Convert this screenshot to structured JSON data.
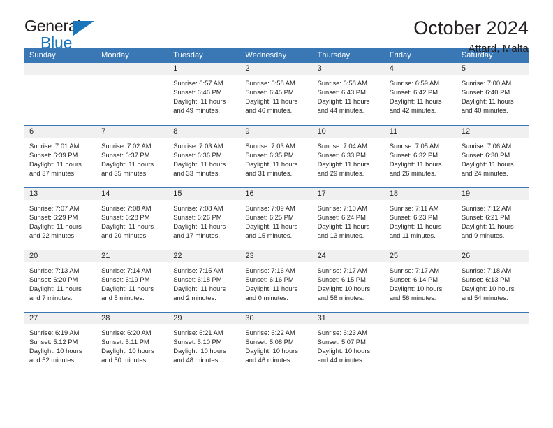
{
  "brand": {
    "name_line1": "General",
    "name_line2": "Blue",
    "accent_color": "#1b75bb"
  },
  "header": {
    "title": "October 2024",
    "subtitle": "Attard, Malta"
  },
  "calendar": {
    "header_bg": "#3a78b5",
    "daynum_band_bg": "#f0f0f0",
    "weekday_headers": [
      "Sunday",
      "Monday",
      "Tuesday",
      "Wednesday",
      "Thursday",
      "Friday",
      "Saturday"
    ],
    "labels": {
      "sunrise": "Sunrise:",
      "sunset": "Sunset:",
      "daylight": "Daylight:"
    },
    "weeks": [
      [
        {
          "empty": true
        },
        {
          "empty": true
        },
        {
          "day": "1",
          "sunrise": "Sunrise: 6:57 AM",
          "sunset": "Sunset: 6:46 PM",
          "daylight_1": "Daylight: 11 hours",
          "daylight_2": "and 49 minutes."
        },
        {
          "day": "2",
          "sunrise": "Sunrise: 6:58 AM",
          "sunset": "Sunset: 6:45 PM",
          "daylight_1": "Daylight: 11 hours",
          "daylight_2": "and 46 minutes."
        },
        {
          "day": "3",
          "sunrise": "Sunrise: 6:58 AM",
          "sunset": "Sunset: 6:43 PM",
          "daylight_1": "Daylight: 11 hours",
          "daylight_2": "and 44 minutes."
        },
        {
          "day": "4",
          "sunrise": "Sunrise: 6:59 AM",
          "sunset": "Sunset: 6:42 PM",
          "daylight_1": "Daylight: 11 hours",
          "daylight_2": "and 42 minutes."
        },
        {
          "day": "5",
          "sunrise": "Sunrise: 7:00 AM",
          "sunset": "Sunset: 6:40 PM",
          "daylight_1": "Daylight: 11 hours",
          "daylight_2": "and 40 minutes."
        }
      ],
      [
        {
          "day": "6",
          "sunrise": "Sunrise: 7:01 AM",
          "sunset": "Sunset: 6:39 PM",
          "daylight_1": "Daylight: 11 hours",
          "daylight_2": "and 37 minutes."
        },
        {
          "day": "7",
          "sunrise": "Sunrise: 7:02 AM",
          "sunset": "Sunset: 6:37 PM",
          "daylight_1": "Daylight: 11 hours",
          "daylight_2": "and 35 minutes."
        },
        {
          "day": "8",
          "sunrise": "Sunrise: 7:03 AM",
          "sunset": "Sunset: 6:36 PM",
          "daylight_1": "Daylight: 11 hours",
          "daylight_2": "and 33 minutes."
        },
        {
          "day": "9",
          "sunrise": "Sunrise: 7:03 AM",
          "sunset": "Sunset: 6:35 PM",
          "daylight_1": "Daylight: 11 hours",
          "daylight_2": "and 31 minutes."
        },
        {
          "day": "10",
          "sunrise": "Sunrise: 7:04 AM",
          "sunset": "Sunset: 6:33 PM",
          "daylight_1": "Daylight: 11 hours",
          "daylight_2": "and 29 minutes."
        },
        {
          "day": "11",
          "sunrise": "Sunrise: 7:05 AM",
          "sunset": "Sunset: 6:32 PM",
          "daylight_1": "Daylight: 11 hours",
          "daylight_2": "and 26 minutes."
        },
        {
          "day": "12",
          "sunrise": "Sunrise: 7:06 AM",
          "sunset": "Sunset: 6:30 PM",
          "daylight_1": "Daylight: 11 hours",
          "daylight_2": "and 24 minutes."
        }
      ],
      [
        {
          "day": "13",
          "sunrise": "Sunrise: 7:07 AM",
          "sunset": "Sunset: 6:29 PM",
          "daylight_1": "Daylight: 11 hours",
          "daylight_2": "and 22 minutes."
        },
        {
          "day": "14",
          "sunrise": "Sunrise: 7:08 AM",
          "sunset": "Sunset: 6:28 PM",
          "daylight_1": "Daylight: 11 hours",
          "daylight_2": "and 20 minutes."
        },
        {
          "day": "15",
          "sunrise": "Sunrise: 7:08 AM",
          "sunset": "Sunset: 6:26 PM",
          "daylight_1": "Daylight: 11 hours",
          "daylight_2": "and 17 minutes."
        },
        {
          "day": "16",
          "sunrise": "Sunrise: 7:09 AM",
          "sunset": "Sunset: 6:25 PM",
          "daylight_1": "Daylight: 11 hours",
          "daylight_2": "and 15 minutes."
        },
        {
          "day": "17",
          "sunrise": "Sunrise: 7:10 AM",
          "sunset": "Sunset: 6:24 PM",
          "daylight_1": "Daylight: 11 hours",
          "daylight_2": "and 13 minutes."
        },
        {
          "day": "18",
          "sunrise": "Sunrise: 7:11 AM",
          "sunset": "Sunset: 6:23 PM",
          "daylight_1": "Daylight: 11 hours",
          "daylight_2": "and 11 minutes."
        },
        {
          "day": "19",
          "sunrise": "Sunrise: 7:12 AM",
          "sunset": "Sunset: 6:21 PM",
          "daylight_1": "Daylight: 11 hours",
          "daylight_2": "and 9 minutes."
        }
      ],
      [
        {
          "day": "20",
          "sunrise": "Sunrise: 7:13 AM",
          "sunset": "Sunset: 6:20 PM",
          "daylight_1": "Daylight: 11 hours",
          "daylight_2": "and 7 minutes."
        },
        {
          "day": "21",
          "sunrise": "Sunrise: 7:14 AM",
          "sunset": "Sunset: 6:19 PM",
          "daylight_1": "Daylight: 11 hours",
          "daylight_2": "and 5 minutes."
        },
        {
          "day": "22",
          "sunrise": "Sunrise: 7:15 AM",
          "sunset": "Sunset: 6:18 PM",
          "daylight_1": "Daylight: 11 hours",
          "daylight_2": "and 2 minutes."
        },
        {
          "day": "23",
          "sunrise": "Sunrise: 7:16 AM",
          "sunset": "Sunset: 6:16 PM",
          "daylight_1": "Daylight: 11 hours",
          "daylight_2": "and 0 minutes."
        },
        {
          "day": "24",
          "sunrise": "Sunrise: 7:17 AM",
          "sunset": "Sunset: 6:15 PM",
          "daylight_1": "Daylight: 10 hours",
          "daylight_2": "and 58 minutes."
        },
        {
          "day": "25",
          "sunrise": "Sunrise: 7:17 AM",
          "sunset": "Sunset: 6:14 PM",
          "daylight_1": "Daylight: 10 hours",
          "daylight_2": "and 56 minutes."
        },
        {
          "day": "26",
          "sunrise": "Sunrise: 7:18 AM",
          "sunset": "Sunset: 6:13 PM",
          "daylight_1": "Daylight: 10 hours",
          "daylight_2": "and 54 minutes."
        }
      ],
      [
        {
          "day": "27",
          "sunrise": "Sunrise: 6:19 AM",
          "sunset": "Sunset: 5:12 PM",
          "daylight_1": "Daylight: 10 hours",
          "daylight_2": "and 52 minutes."
        },
        {
          "day": "28",
          "sunrise": "Sunrise: 6:20 AM",
          "sunset": "Sunset: 5:11 PM",
          "daylight_1": "Daylight: 10 hours",
          "daylight_2": "and 50 minutes."
        },
        {
          "day": "29",
          "sunrise": "Sunrise: 6:21 AM",
          "sunset": "Sunset: 5:10 PM",
          "daylight_1": "Daylight: 10 hours",
          "daylight_2": "and 48 minutes."
        },
        {
          "day": "30",
          "sunrise": "Sunrise: 6:22 AM",
          "sunset": "Sunset: 5:08 PM",
          "daylight_1": "Daylight: 10 hours",
          "daylight_2": "and 46 minutes."
        },
        {
          "day": "31",
          "sunrise": "Sunrise: 6:23 AM",
          "sunset": "Sunset: 5:07 PM",
          "daylight_1": "Daylight: 10 hours",
          "daylight_2": "and 44 minutes."
        },
        {
          "empty": true
        },
        {
          "empty": true
        }
      ]
    ]
  }
}
